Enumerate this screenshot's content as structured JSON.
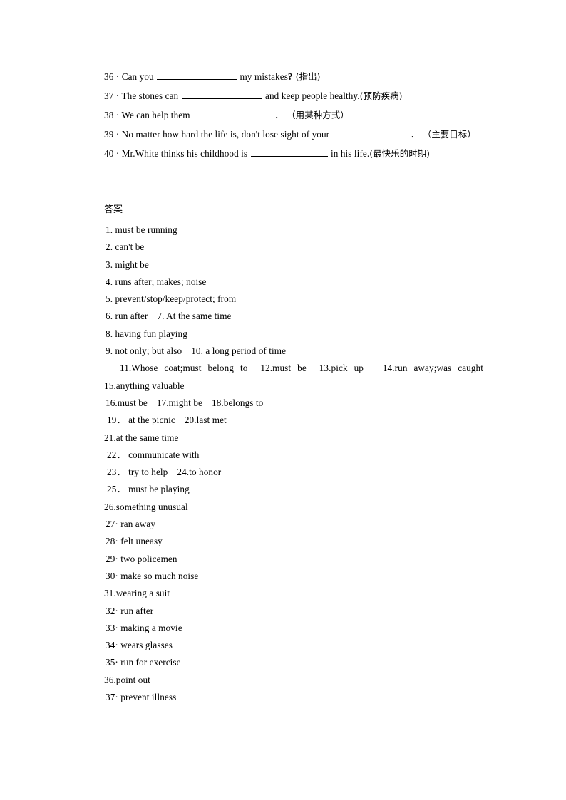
{
  "document": {
    "page_background": "#ffffff",
    "text_color": "#000000"
  },
  "questions": {
    "items": [
      {
        "number": "36",
        "sep": "·",
        "pre": "Can you ",
        "blank": true,
        "post": " my mistakes",
        "qmark": "?",
        "hint": " (指出)"
      },
      {
        "number": "37",
        "sep": "·",
        "pre": "The stones can ",
        "blank": true,
        "post": " and keep people healthy.",
        "qmark": "",
        "hint": "(预防疾病)"
      },
      {
        "number": "38",
        "sep": "·",
        "pre": "We can help them",
        "blank": true,
        "post": " ．",
        "qmark": "",
        "hint": " （用某种方式）"
      },
      {
        "number": "39",
        "sep": "·",
        "pre": "No matter how hard the life is, don't lose sight of your ",
        "blank": true,
        "post": "．",
        "qmark": "",
        "hint": " （主要目标）"
      },
      {
        "number": "40",
        "sep": "·",
        "pre": "Mr.White thinks his childhood is ",
        "blank": true,
        "post": " in his life.",
        "qmark": "",
        "hint": "(最快乐的时期)"
      }
    ]
  },
  "answers": {
    "heading": "答案",
    "lines": [
      "1. must be running",
      "2. can't be",
      "3. might be",
      "4. runs after; makes; noise",
      "5. prevent/stop/keep/protect; from"
    ],
    "line_6_7_a": "6. run after",
    "line_6_7_b": "7. At the same time",
    "line_8": "8. having fun playing",
    "line_9_10_a": "9. not only; but also",
    "line_9_10_b": "10. a long period of time",
    "paragraph_items": [
      "11.Whose coat;must belong to",
      "12.must be",
      "13.pick up",
      "14.run away;was caught",
      "15.anything valuable"
    ],
    "line_16_18_a": "16.must be",
    "line_16_18_b": "17.might be",
    "line_16_18_c": "18.belongs to",
    "line_19_20_a": "19． at the picnic",
    "line_19_20_b": "20.last met",
    "line_21": "21.at the same time",
    "line_22": "22． communicate with",
    "line_23_24_a": "23． try to help",
    "line_23_24_b": "24.to honor",
    "line_25": "25． must be playing",
    "line_26": "26.something unusual",
    "line_27": "27· ran away",
    "line_28": "28· felt uneasy",
    "line_29": "29· two policemen",
    "line_30": "30· make so much noise",
    "line_31": "31.wearing a suit",
    "line_32": "32· run after",
    "line_33": "33· making a movie",
    "line_34": "34· wears glasses",
    "line_35": "35· run for exercise",
    "line_36": "36.point out",
    "line_37": "37· prevent illness"
  }
}
